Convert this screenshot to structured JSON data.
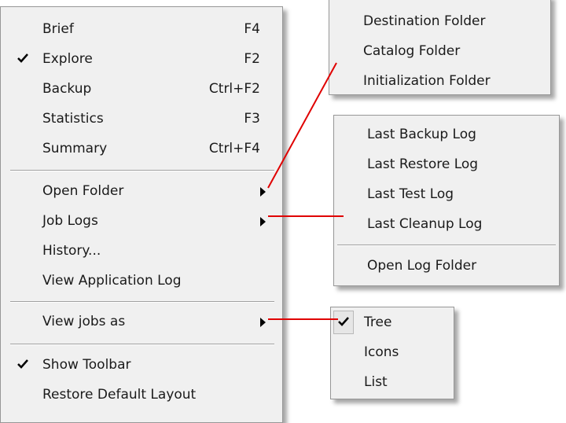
{
  "main_menu": {
    "items": [
      {
        "label": "Brief",
        "shortcut": "F4",
        "checked": false
      },
      {
        "label": "Explore",
        "shortcut": "F2",
        "checked": true
      },
      {
        "label": "Backup",
        "shortcut": "Ctrl+F2",
        "checked": false
      },
      {
        "label": "Statistics",
        "shortcut": "F3",
        "checked": false
      },
      {
        "label": "Summary",
        "shortcut": "Ctrl+F4",
        "checked": false
      },
      {
        "label": "Open Folder",
        "submenu": true
      },
      {
        "label": "Job Logs",
        "submenu": true
      },
      {
        "label": "History..."
      },
      {
        "label": "View Application Log"
      },
      {
        "label": "View jobs as",
        "submenu": true
      },
      {
        "label": "Show Toolbar",
        "checked": true
      },
      {
        "label": "Restore Default Layout"
      }
    ]
  },
  "folder_submenu": {
    "items": [
      {
        "label": "Destination Folder"
      },
      {
        "label": "Catalog Folder"
      },
      {
        "label": "Initialization Folder"
      }
    ]
  },
  "logs_submenu": {
    "items": [
      {
        "label": "Last Backup Log"
      },
      {
        "label": "Last Restore Log"
      },
      {
        "label": "Last Test Log"
      },
      {
        "label": "Last Cleanup Log"
      },
      {
        "label": "Open Log Folder"
      }
    ]
  },
  "view_submenu": {
    "items": [
      {
        "label": "Tree",
        "checked": true
      },
      {
        "label": "Icons"
      },
      {
        "label": "List"
      }
    ]
  },
  "colors": {
    "menu_bg": "#f0f0f0",
    "connector": "#e00000"
  }
}
